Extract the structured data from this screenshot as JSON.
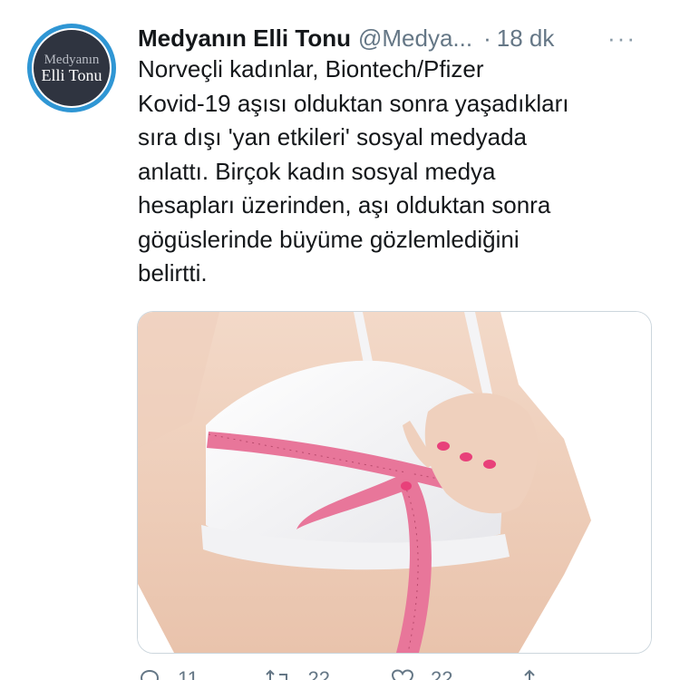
{
  "tweet": {
    "avatar": {
      "line1": "Medyanın",
      "line2": "Elli Tonu"
    },
    "display_name": "Medyanın Elli Tonu",
    "handle": "@Medya...",
    "separator": "·",
    "time": "18 dk",
    "more_label": "···",
    "text": "Norveçli kadınlar, Biontech/Pfizer\nKovid-19 aşısı olduktan sonra yaşadıkları\nsıra dışı 'yan etkileri' sosyal medyada\nanlattı. Birçok kadın sosyal medya\nhesapları üzerinden, aşı olduktan sonra\ngögüslerinde büyüme gözlemlediğini\nbelirtti.",
    "actions": {
      "reply_count": "11",
      "retweet_count": "22",
      "like_count": "22"
    }
  },
  "colors": {
    "avatar_ring": "#2f96d4",
    "avatar_bg": "#2f3440",
    "secondary_text": "#657786",
    "primary_text": "#14171a"
  }
}
